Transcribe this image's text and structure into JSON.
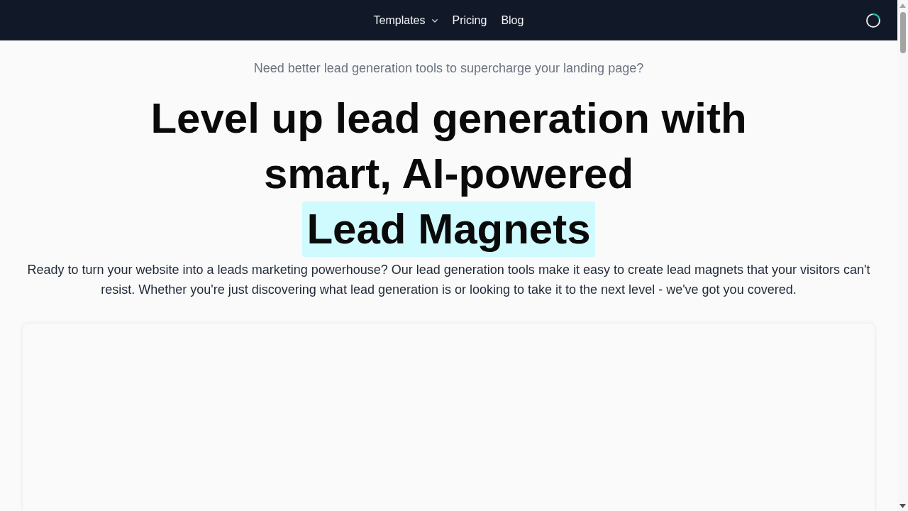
{
  "nav": {
    "links": [
      {
        "label": "Templates",
        "dropdown": true
      },
      {
        "label": "Pricing",
        "dropdown": false
      },
      {
        "label": "Blog",
        "dropdown": false
      }
    ],
    "loading": true
  },
  "hero": {
    "eyebrow": "Need better lead generation tools to supercharge your landing page?",
    "headline": "Level up lead generation with smart, AI-powered",
    "highlight": "Lead Magnets",
    "description": "Ready to turn your website into a leads marketing powerhouse? Our lead generation tools make it easy to create lead magnets that your visitors can't resist. Whether you're just discovering what lead generation is or looking to take it to the next level - we've got you covered."
  }
}
